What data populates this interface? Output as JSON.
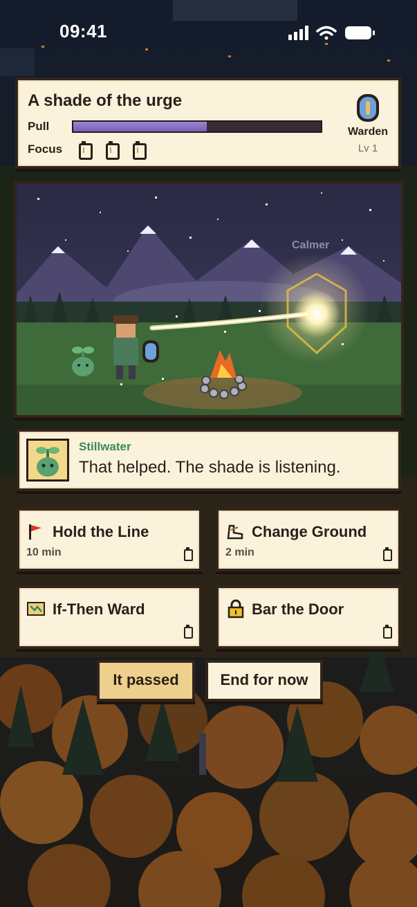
{
  "status_bar": {
    "time": "09:41"
  },
  "encounter": {
    "title": "A shade of the urge",
    "pull_label": "Pull",
    "pull_level": 0.54,
    "focus_label": "Focus",
    "focus_count": 3
  },
  "player": {
    "rank": "Warden",
    "level": "Lv 1"
  },
  "scene": {
    "enemy_label": "Calmer"
  },
  "companion": {
    "name": "Stillwater",
    "message": "That helped. The shade is listening."
  },
  "choices": [
    {
      "label": "Hold the Line",
      "duration": "10 min",
      "icon": "flag-icon"
    },
    {
      "label": "Change Ground",
      "duration": "2 min",
      "icon": "boot-icon"
    },
    {
      "label": "If-Then Ward",
      "duration": "",
      "icon": "map-icon"
    },
    {
      "label": "Bar the Door",
      "duration": "",
      "icon": "padlock-icon"
    }
  ],
  "actions": {
    "passed_label": "It passed",
    "end_label": "End for now"
  },
  "colors": {
    "panel": "#fbf2dc",
    "border": "#33241c",
    "pull_bar": "#8a74c8",
    "accent_green": "#3a8a58",
    "passed_button": "#edcf8e"
  }
}
